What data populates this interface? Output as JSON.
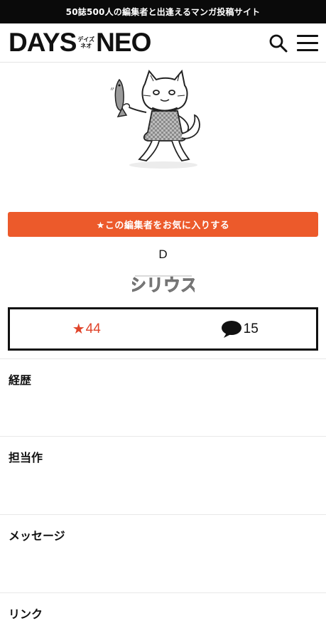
{
  "topbar": {
    "text": "50誌500人の編集者と出逢えるマンガ投稿サイト"
  },
  "header": {
    "logo_left": "DAYS",
    "logo_ruby_top": "デイズ",
    "logo_ruby_bottom": "ネオ",
    "logo_right": "NEO",
    "search_icon": "search-icon",
    "menu_icon": "hamburger-menu-icon"
  },
  "editor": {
    "favorite_button": "★この編集者をお気に入りする",
    "name": "D",
    "magazine_logo_text": "シリウス"
  },
  "stats": {
    "favorites_icon": "★",
    "favorites": "44",
    "comments": "15"
  },
  "sections": [
    {
      "title": "経歴"
    },
    {
      "title": "担当作"
    },
    {
      "title": "メッセージ"
    },
    {
      "title": "リンク"
    }
  ],
  "colors": {
    "accent": "#ec5a2b",
    "star": "#e0442a",
    "topbar": "#0a0a0a"
  }
}
